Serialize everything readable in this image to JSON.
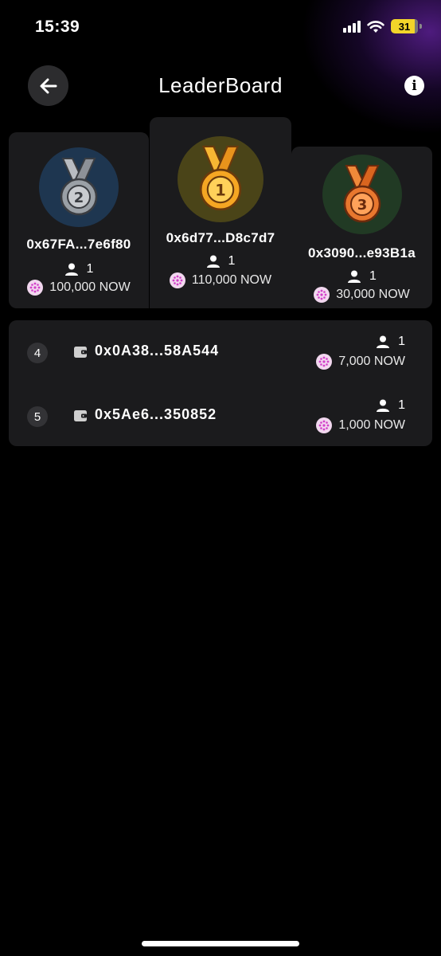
{
  "status_bar": {
    "time": "15:39",
    "battery": "31"
  },
  "header": {
    "title": "LeaderBoard",
    "back_icon": "arrow-left-icon",
    "info_icon": "info-icon"
  },
  "colors": {
    "background": "#000000",
    "card": "#1b1b1d",
    "accent_glow": "#6824a8",
    "gold": "#f5a623",
    "silver": "#9aa0a6",
    "bronze": "#e8772e",
    "token": "#e05ad4"
  },
  "podium": [
    {
      "rank": 2,
      "medal": "silver-medal-icon",
      "address": "0x67FA...7e6f80",
      "count": "1",
      "amount": "100,000 NOW"
    },
    {
      "rank": 1,
      "medal": "gold-medal-icon",
      "address": "0x6d77...D8c7d7",
      "count": "1",
      "amount": "110,000 NOW"
    },
    {
      "rank": 3,
      "medal": "bronze-medal-icon",
      "address": "0x3090...e93B1a",
      "count": "1",
      "amount": "30,000 NOW"
    }
  ],
  "ranking": [
    {
      "rank": "4",
      "address": "0x0A38...58A544",
      "count": "1",
      "amount": "7,000 NOW"
    },
    {
      "rank": "5",
      "address": "0x5Ae6...350852",
      "count": "1",
      "amount": "1,000 NOW"
    }
  ]
}
